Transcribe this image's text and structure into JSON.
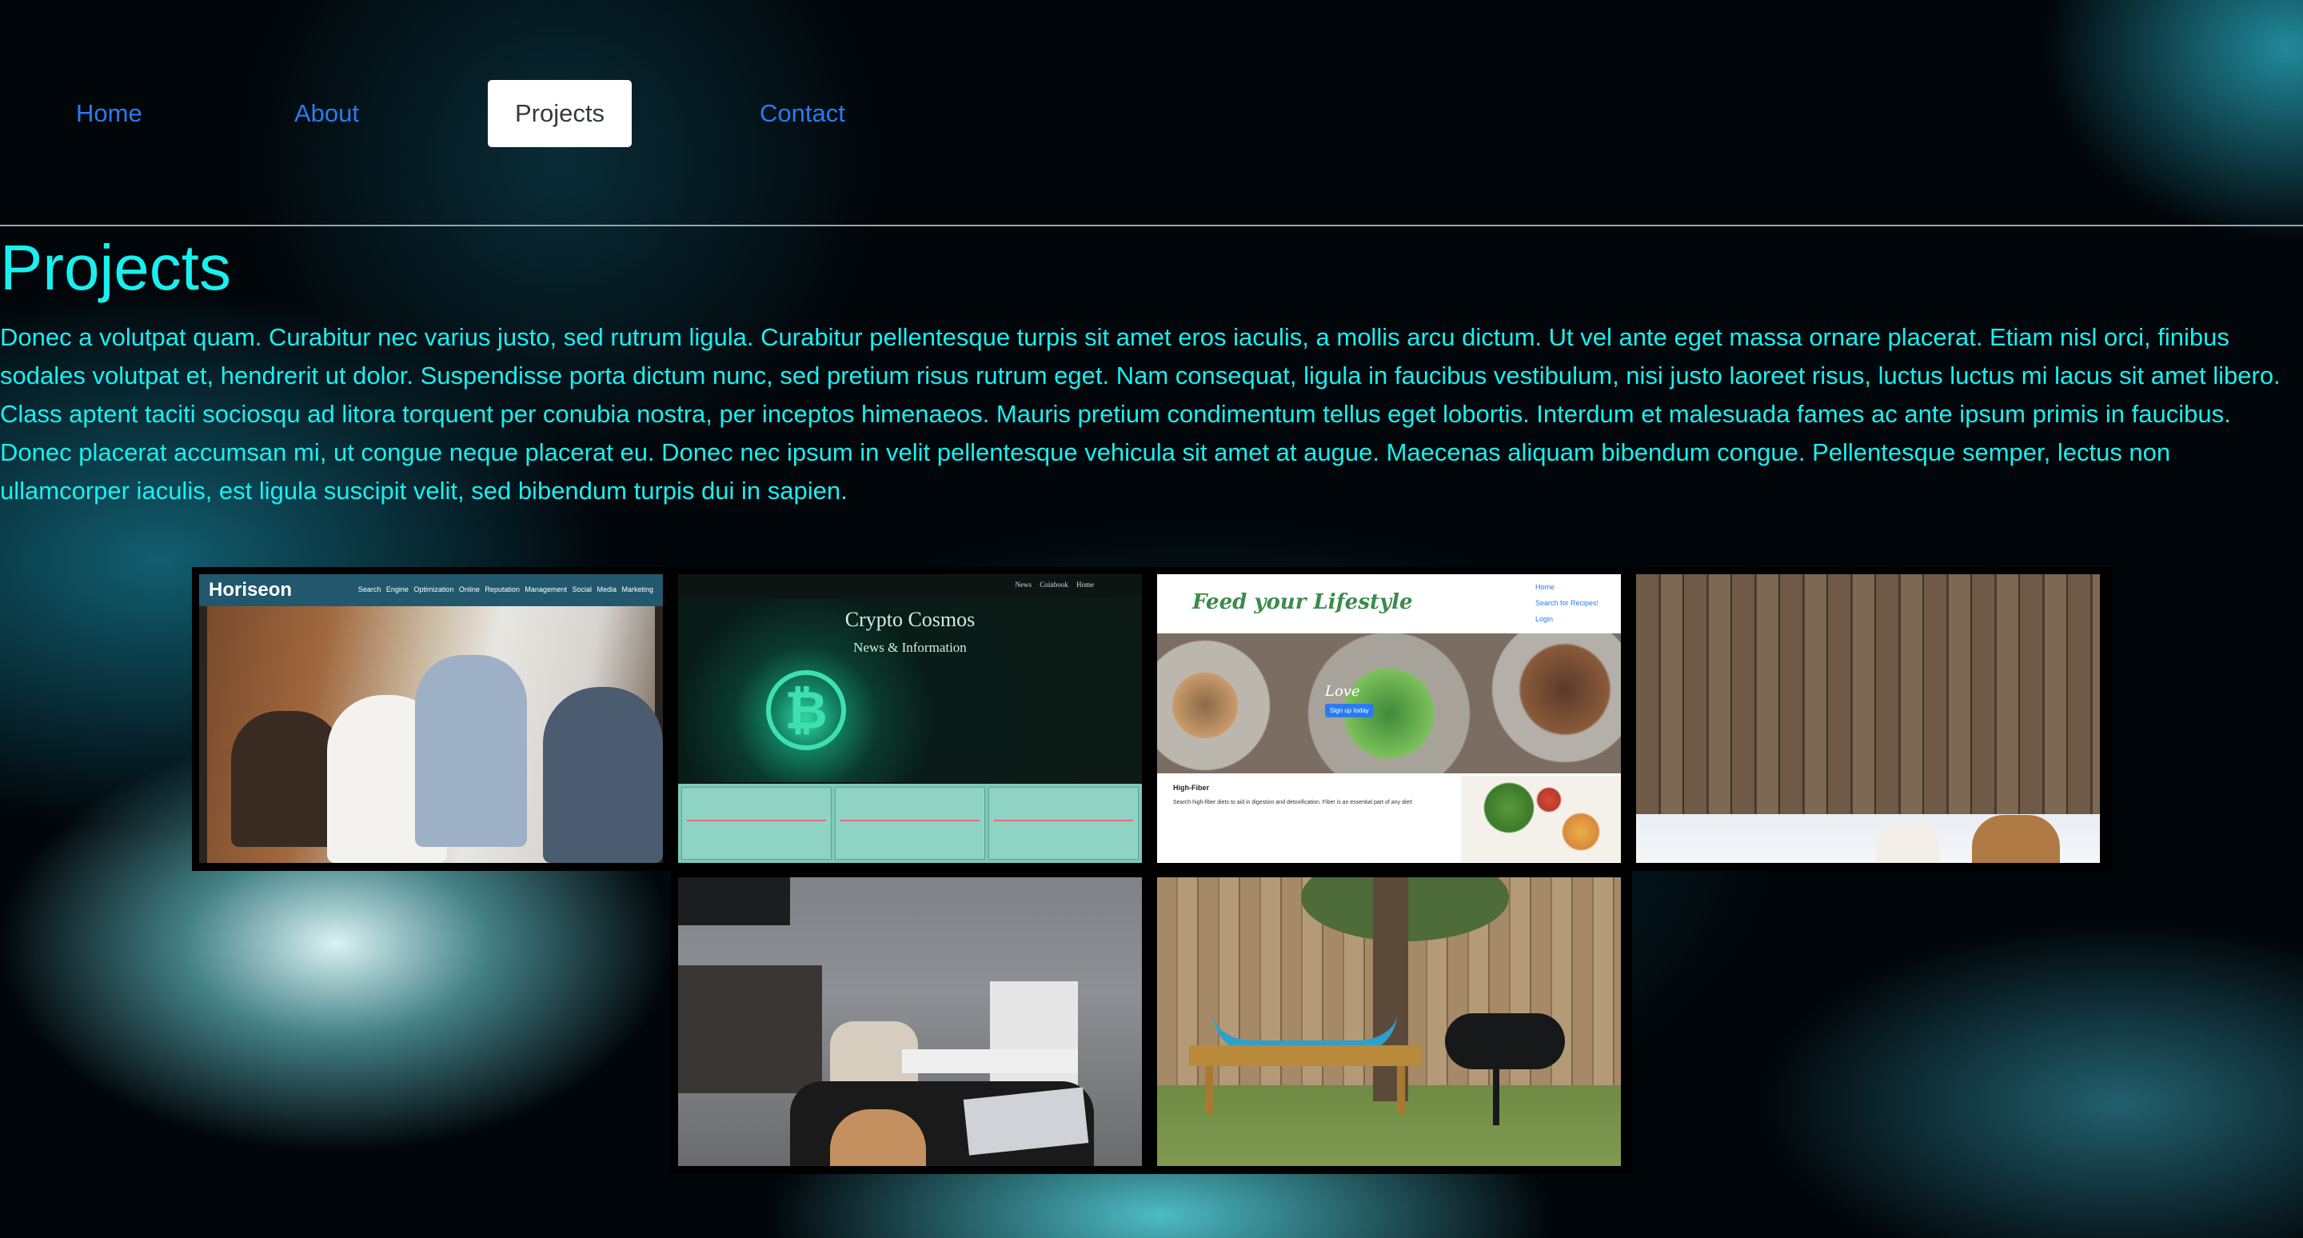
{
  "nav": {
    "items": [
      {
        "label": "Home",
        "active": false
      },
      {
        "label": "About",
        "active": false
      },
      {
        "label": "Projects",
        "active": true
      },
      {
        "label": "Contact",
        "active": false
      }
    ]
  },
  "page": {
    "title": "Projects",
    "intro": "Donec a volutpat quam. Curabitur nec varius justo, sed rutrum ligula. Curabitur pellentesque turpis sit amet eros iaculis, a mollis arcu dictum. Ut vel ante eget massa ornare placerat. Etiam nisl orci, finibus sodales volutpat et, hendrerit ut dolor. Suspendisse porta dictum nunc, sed pretium risus rutrum eget. Nam consequat, ligula in faucibus vestibulum, nisi justo laoreet risus, luctus luctus mi lacus sit amet libero. Class aptent taciti sociosqu ad litora torquent per conubia nostra, per inceptos himenaeos. Mauris pretium condimentum tellus eget lobortis. Interdum et malesuada fames ac ante ipsum primis in faucibus. Donec placerat accumsan mi, ut congue neque placerat eu. Donec nec ipsum in velit pellentesque vehicula sit amet at augue. Maecenas aliquam bibendum congue. Pellentesque semper, lectus non ullamcorper iaculis, est ligula suscipit velit, sed bibendum turpis dui in sapien."
  },
  "colors": {
    "accent": "#18f0f0",
    "nav_link": "#2a7bf0",
    "nav_active_bg": "#ffffff"
  },
  "gallery": {
    "horiseon": {
      "brand": "Horiseon",
      "links": "Search Engine Optimization  Online Reputation Management  Social Media Marketing"
    },
    "crypto": {
      "nav": "News  Coinbook  Home",
      "title": "Crypto Cosmos",
      "subtitle": "News & Information",
      "symbol": "₿"
    },
    "feed": {
      "logo": "Feed your Lifestyle",
      "menu": [
        "Home",
        "Search for Recipes!",
        "Login"
      ],
      "hero_text": "Love",
      "signup": "Sign up today",
      "section_title": "High-Fiber",
      "section_text": "Search high-fiber diets to aid in digestion and detoxification. Fiber is an essential part of any diet!"
    },
    "photos": [
      "backyard-fence-dogs",
      "living-room-dog",
      "backyard-hammock-grill"
    ]
  }
}
